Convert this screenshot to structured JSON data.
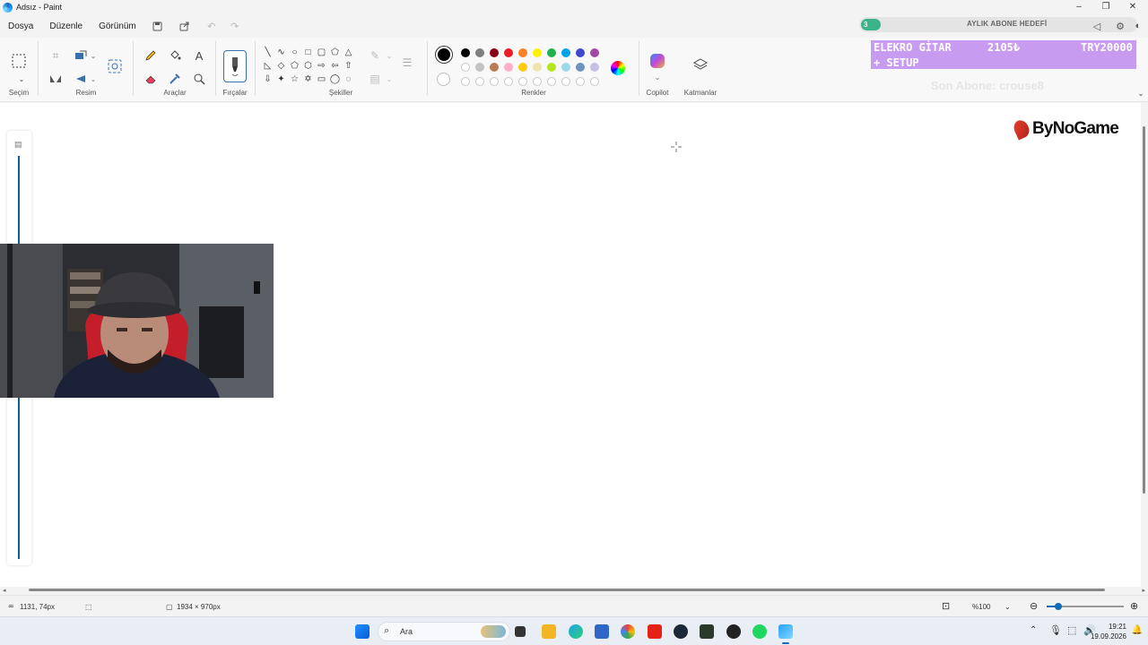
{
  "window": {
    "title": "Adsız - Paint",
    "minimize": "–",
    "restore": "❐",
    "close": "✕"
  },
  "menu": {
    "file": "Dosya",
    "edit": "Düzenle",
    "view": "Görünüm"
  },
  "ribbon": {
    "groups": {
      "selection": "Seçim",
      "image": "Resim",
      "tools": "Araçlar",
      "brushes": "Fırçalar",
      "shapes": "Şekiller",
      "colors": "Renkler",
      "copilot": "Copilot",
      "layers": "Katmanlar"
    },
    "palette_row1": [
      "#000000",
      "#7f7f7f",
      "#880015",
      "#ed1c24",
      "#ff7f27",
      "#fff200",
      "#22b14c",
      "#00a2e8",
      "#3f48cc",
      "#a349a4"
    ],
    "palette_row2": [
      "#ffffff",
      "#c3c3c3",
      "#b97a57",
      "#ffaec9",
      "#ffc90e",
      "#efe4b0",
      "#b5e61d",
      "#99d9ea",
      "#7092be",
      "#c8bfe7"
    ],
    "primary_color": "#000000",
    "secondary_color": "#ffffff"
  },
  "overlay": {
    "goal_count": "3",
    "goal_title": "AYLIK ABONE HEDEFİ",
    "goal_item": "ELEKRO GİTAR",
    "goal_current": "2105₺",
    "goal_target": "TRY20000",
    "goal_item2": "+ SETUP",
    "last_sub": "Son Abone: crouse8"
  },
  "canvas": {
    "logo_text": "ByNoGame"
  },
  "status": {
    "cursor_pos": "1131, 74px",
    "canvas_size": "1934 × 970px",
    "zoom": "%100"
  },
  "taskbar": {
    "search_placeholder": "Ara",
    "time": "19:21",
    "date": "19.09.2026"
  }
}
